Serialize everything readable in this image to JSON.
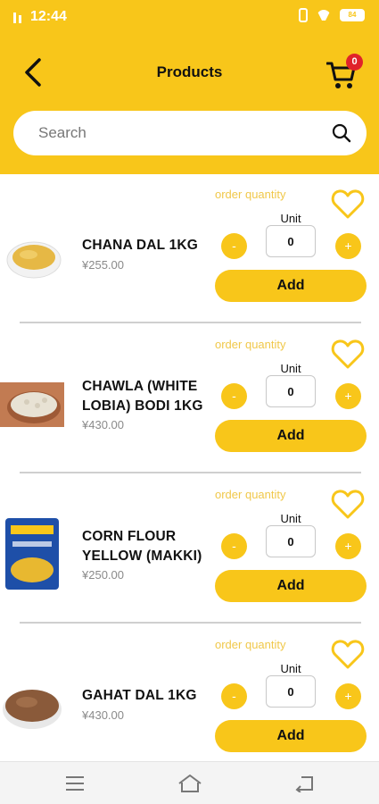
{
  "status": {
    "time": "12:44",
    "battery": "84"
  },
  "header": {
    "title": "Products",
    "cart_count": "0"
  },
  "search": {
    "placeholder": "Search"
  },
  "theme": {
    "accent": "#F8C61A",
    "badge": "#E0232A"
  },
  "products": [
    {
      "name": "CHANA DAL 1KG",
      "price": "¥255.00",
      "order_label": "order quantity",
      "unit_label": "Unit",
      "quantity": "0",
      "minus": "-",
      "plus": "+",
      "add_label": "Add"
    },
    {
      "name": "CHAWLA (WHITE LOBIA) BODI 1KG",
      "price": "¥430.00",
      "order_label": "order quantity",
      "unit_label": "Unit",
      "quantity": "0",
      "minus": "-",
      "plus": "+",
      "add_label": "Add"
    },
    {
      "name": "CORN FLOUR YELLOW (MAKKI)",
      "price": "¥250.00",
      "order_label": "order quantity",
      "unit_label": "Unit",
      "quantity": "0",
      "minus": "-",
      "plus": "+",
      "add_label": "Add"
    },
    {
      "name": "GAHAT DAL 1KG",
      "price": "¥430.00",
      "order_label": "order quantity",
      "unit_label": "Unit",
      "quantity": "0",
      "minus": "-",
      "plus": "+",
      "add_label": "Add"
    }
  ],
  "icons": {
    "back": "back-arrow-icon",
    "cart": "cart-icon",
    "search": "search-icon",
    "favorite": "heart-icon",
    "nav": [
      "menu-icon",
      "home-icon",
      "back-icon"
    ]
  }
}
